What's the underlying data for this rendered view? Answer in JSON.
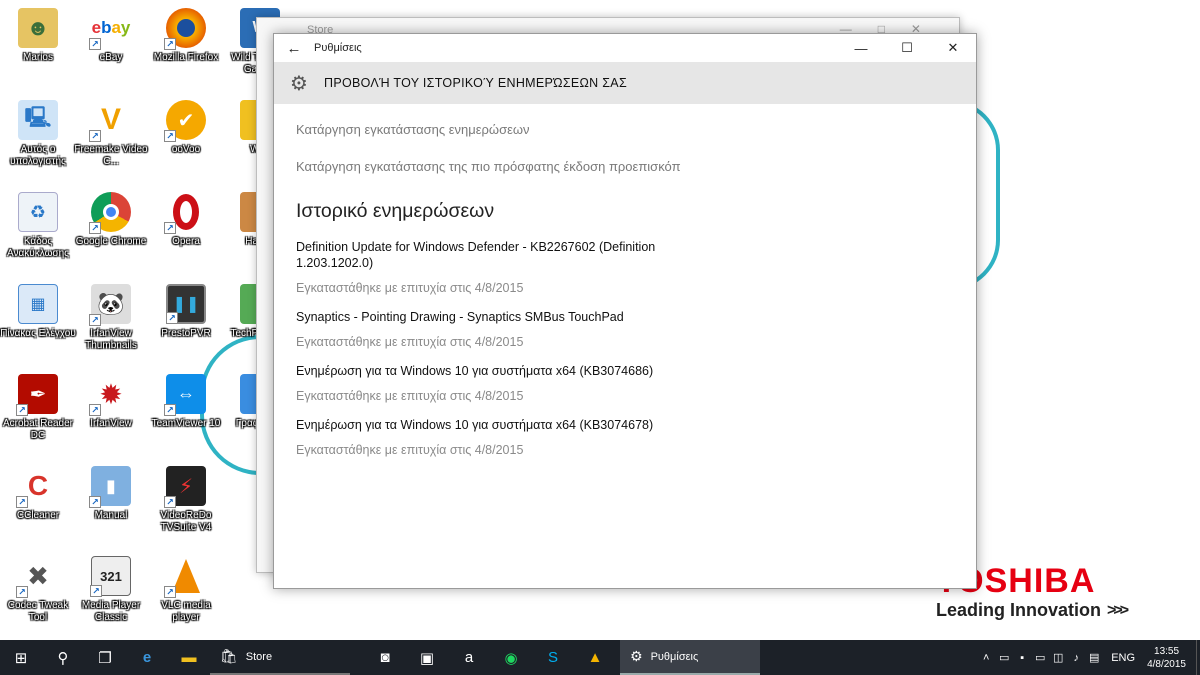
{
  "desktop": {
    "icons": [
      {
        "label": "Marios"
      },
      {
        "label": "eBay"
      },
      {
        "label": "Mozilla Firefox"
      },
      {
        "label": "Wild Tangent Games"
      },
      {
        "label": "Αυτός ο υπολογιστής"
      },
      {
        "label": "Freemake Video C..."
      },
      {
        "label": "ooVoo"
      },
      {
        "label": "Wi..."
      },
      {
        "label": "Κάδος Ανακύκλωσης"
      },
      {
        "label": "Google Chrome"
      },
      {
        "label": "Opera"
      },
      {
        "label": "Ham..."
      },
      {
        "label": "Πίνακας Ελέγχου"
      },
      {
        "label": "IrfanView Thumbnails"
      },
      {
        "label": "PrestoPVR"
      },
      {
        "label": "TechP... GP..."
      },
      {
        "label": "Acrobat Reader DC"
      },
      {
        "label": "IrfanView"
      },
      {
        "label": "TeamViewer 10"
      },
      {
        "label": "Γραφ... Ir..."
      },
      {
        "label": "CCleaner"
      },
      {
        "label": "Manual"
      },
      {
        "label": "VideoReDo TVSuite V4"
      },
      {
        "label": "Codec Tweak Tool"
      },
      {
        "label": "Media Player Classic"
      },
      {
        "label": "VLC media player"
      }
    ],
    "brand": {
      "logo": "TOSHIBA",
      "tagline": "Leading Innovation",
      "arrows": ">>>"
    }
  },
  "store_window": {
    "title": "Store"
  },
  "settings_window": {
    "title": "Ρυθμίσεις",
    "back_icon": "back-arrow-icon",
    "header_title": "ΠΡΟΒΟΛΉ ΤΟΥ ΙΣΤΟΡΙΚΟΎ ΕΝΗΜΕΡΏΣΕΩΝ ΣΑΣ",
    "links": {
      "uninstall_updates": "Κατάργηση εγκατάστασης ενημερώσεων",
      "uninstall_preview": "Κατάργηση εγκατάστασης της πιο πρόσφατης έκδοση προεπισκόπ"
    },
    "section_title": "Ιστορικό ενημερώσεων",
    "updates": [
      {
        "name": "Definition Update for Windows Defender - KB2267602 (Definition 1.203.1202.0)",
        "status": "Εγκαταστάθηκε με επιτυχία στις 4/8/2015"
      },
      {
        "name": "Synaptics - Pointing Drawing - Synaptics SMBus TouchPad",
        "status": "Εγκαταστάθηκε με επιτυχία στις 4/8/2015"
      },
      {
        "name": "Ενημέρωση για τα Windows 10 για συστήματα x64 (KB3074686)",
        "status": "Εγκαταστάθηκε με επιτυχία στις 4/8/2015"
      },
      {
        "name": "Ενημέρωση για τα Windows 10 για συστήματα x64 (KB3074678)",
        "status": "Εγκαταστάθηκε με επιτυχία στις 4/8/2015"
      }
    ]
  },
  "taskbar": {
    "apps": {
      "store": "Store",
      "settings": "Ρυθμίσεις"
    },
    "language": "ENG",
    "time": "13:55",
    "date": "4/8/2015"
  },
  "colors": {
    "taskbar": "#1c2128",
    "accent_curve": "#2fb3c4",
    "toshiba_red": "#e60012",
    "header_bg": "#e6e6e6"
  }
}
